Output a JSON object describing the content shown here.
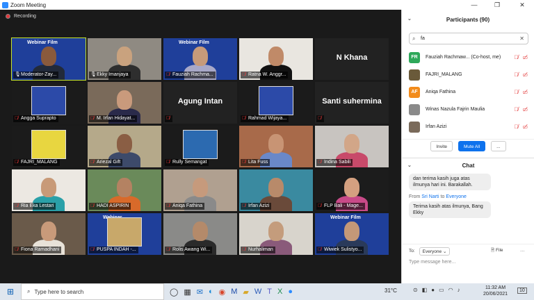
{
  "window": {
    "title": "Zoom Meeting",
    "minimize": "—",
    "restore": "❐",
    "close": "✕"
  },
  "recording": {
    "label": "Recording"
  },
  "tiles": [
    {
      "name": "Moderator-Zay...",
      "bg": "#1f3f9a",
      "skin": "#8a5a3c",
      "shirt": "#222a3a",
      "banner": "Webinar Film",
      "active": true,
      "muted": false
    },
    {
      "name": "Ekky Imanjaya",
      "bg": "#8f8a82",
      "skin": "#c9a27e",
      "shirt": "#2e2e2e",
      "muted": false
    },
    {
      "name": "Fauziah Rachma...",
      "bg": "#1f3f9a",
      "skin": "#c69a7a",
      "shirt": "#a8a8c8",
      "banner": "Webinar Film",
      "muted": true
    },
    {
      "name": "Ratna W. Anggr...",
      "bg": "#e9e6e0",
      "skin": "#c08a68",
      "shirt": "#111111",
      "muted": true
    },
    {
      "name": "",
      "big": "N Khana",
      "bg": "#222222",
      "muted": false
    },
    {
      "name": "Angga Suprapto",
      "bg": "#1b1b1b",
      "poster": "#2c4aa8",
      "muted": true
    },
    {
      "name": "M. Irfan Hidayat...",
      "bg": "#7a6a5a",
      "skin": "#c99a7c",
      "shirt": "#2a2a4a",
      "muted": true
    },
    {
      "name": "",
      "big": "Agung Intan",
      "bg": "#222222",
      "muted": true
    },
    {
      "name": "Rahmad Wijaya...",
      "bg": "#1b1b1b",
      "poster": "#2c4aa8",
      "muted": true
    },
    {
      "name": "",
      "big": "Santi suhermina",
      "bg": "#222222",
      "muted": true
    },
    {
      "name": "FAJRI_MALANG",
      "bg": "#1b1b1b",
      "poster": "#e8d640",
      "muted": true
    },
    {
      "name": "Ariezal Gift",
      "bg": "#b5a98a",
      "skin": "#8a5e44",
      "shirt": "#3d4a6a",
      "muted": true
    },
    {
      "name": "Rully Semangat",
      "bg": "#1b1b1b",
      "poster": "#2c6ab0",
      "muted": true
    },
    {
      "name": "Lita Fuss",
      "bg": "#a86a4a",
      "skin": "#c89474",
      "shirt": "#6a88c8",
      "muted": true
    },
    {
      "name": "Indina Sabili",
      "bg": "#c8c4c0",
      "skin": "#d2a688",
      "shirt": "#c84a6a",
      "muted": true
    },
    {
      "name": "Ria Eka Lestari",
      "bg": "#ece8e2",
      "skin": "#c89a78",
      "shirt": "#2aa0a8",
      "muted": true
    },
    {
      "name": "HADI ASPIRIN",
      "bg": "#6a8a5a",
      "skin": "#b48262",
      "shirt": "#d86a2a",
      "muted": true
    },
    {
      "name": "Aniqa Fathina",
      "bg": "#b0a090",
      "skin": "#c69a7c",
      "shirt": "#8a8a8a",
      "muted": true
    },
    {
      "name": "Irfan Azizi",
      "bg": "#3a8aa0",
      "skin": "#b88a6a",
      "shirt": "#6a4a3a",
      "muted": true
    },
    {
      "name": "FLP Bali - Mage...",
      "bg": "#1c1c1c",
      "skin": "#d4a080",
      "shirt": "#c84a88",
      "muted": true
    },
    {
      "name": "Fiona Ramadhani",
      "bg": "#6a5a4a",
      "skin": "#c89a7a",
      "shirt": "#e8e2d8",
      "muted": true
    },
    {
      "name": "PUSPA INDAH -...",
      "bg": "#1f3f9a",
      "poster": "#c8a86a",
      "banner": "Webinar",
      "muted": true
    },
    {
      "name": "Rolis Awang Wi...",
      "bg": "#8a8a88",
      "skin": "#b48a6a",
      "shirt": "#2a2a2a",
      "muted": true
    },
    {
      "name": "Nurhaliman",
      "bg": "#d8d4cc",
      "skin": "#c49c7c",
      "shirt": "#8a5a7a",
      "muted": true
    },
    {
      "name": "Wiwiek Sulistyo...",
      "bg": "#1f3f9a",
      "skin": "#c49878",
      "shirt": "#2a3a5a",
      "banner": "Webinar Film",
      "muted": true
    }
  ],
  "participants": {
    "title": "Participants (90)",
    "search_value": "fa",
    "list": [
      {
        "initials": "FR",
        "color": "#2ea85a",
        "name": "Fauziah Rachmaw... (Co-host, me)"
      },
      {
        "initials": "",
        "color": "#6a5a3a",
        "name": "FAJRI_MALANG"
      },
      {
        "initials": "AF",
        "color": "#f28c1c",
        "name": "Aniqa Fathina"
      },
      {
        "initials": "",
        "color": "#8a8a8a",
        "name": "Winas Nazula Fajrin Maulia"
      },
      {
        "initials": "",
        "color": "#7a6a5a",
        "name": "Irfan Azizi"
      }
    ],
    "invite": "Invite",
    "mute_all": "Mute All",
    "more": "..."
  },
  "chat": {
    "title": "Chat",
    "msg1": "dan terima kasih juga atas ilmunya hari ini. Barakallah.",
    "from_name": "Sri Narti",
    "from_to": "to",
    "from_target": "Everyone",
    "msg2": "Terima kasih atas ilmunya, Bang Ekky",
    "to_label": "To:",
    "to_value": "Everyone",
    "file": "File",
    "more": "···",
    "placeholder": "Type message here..."
  },
  "taskbar": {
    "search_placeholder": "Type here to search",
    "temp": "31°C",
    "time": "11:32 AM",
    "date": "20/06/2021",
    "notif": "10"
  }
}
